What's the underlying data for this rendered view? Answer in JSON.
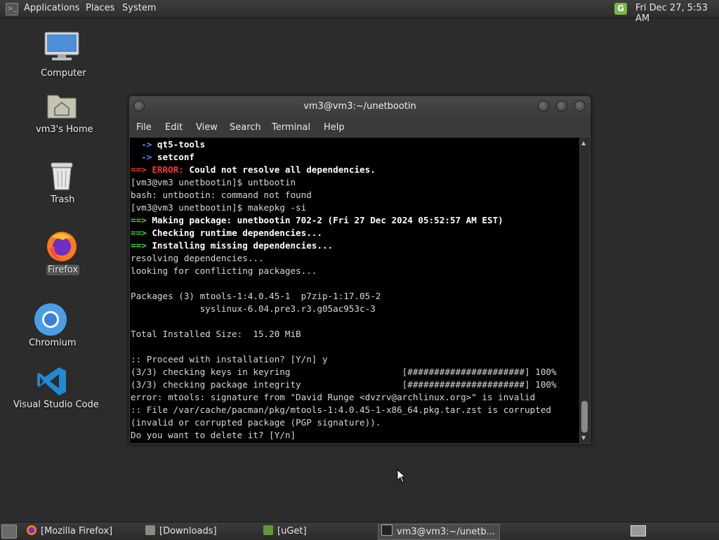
{
  "top_panel": {
    "menu": [
      "Applications",
      "Places",
      "System"
    ],
    "clock": "Fri Dec 27,  5:53 AM"
  },
  "desktop_icons": [
    "Computer",
    "vm3's Home",
    "Trash",
    "Firefox",
    "Chromium",
    "Visual Studio Code"
  ],
  "terminal": {
    "title": "vm3@vm3:~/unetbootin",
    "menu": [
      "File",
      "Edit",
      "View",
      "Search",
      "Terminal",
      "Help"
    ],
    "lines": [
      "  -> qt5-tools",
      "  -> setconf",
      "==> ERROR: Could not resolve all dependencies.",
      "[vm3@vm3 unetbootin]$ untbootin",
      "bash: untbootin: command not found",
      "[vm3@vm3 unetbootin]$ makepkg -si",
      "==> Making package: unetbootin 702-2 (Fri 27 Dec 2024 05:52:57 AM EST)",
      "==> Checking runtime dependencies...",
      "==> Installing missing dependencies...",
      "resolving dependencies...",
      "looking for conflicting packages...",
      "",
      "Packages (3) mtools-1:4.0.45-1  p7zip-1:17.05-2",
      "             syslinux-6.04.pre3.r3.g05ac953c-3",
      "",
      "Total Installed Size:  15.20 MiB",
      "",
      ":: Proceed with installation? [Y/n] y",
      "(3/3) checking keys in keyring                     [######################] 100%",
      "(3/3) checking package integrity                   [######################] 100%",
      "error: mtools: signature from \"David Runge <dvzrv@archlinux.org>\" is invalid",
      ":: File /var/cache/pacman/pkg/mtools-1:4.0.45-1-x86_64.pkg.tar.zst is corrupted",
      "(invalid or corrupted package (PGP signature)).",
      "Do you want to delete it? [Y/n]"
    ]
  },
  "taskbar": {
    "tasks": [
      "[Mozilla Firefox]",
      "[Downloads]",
      "[uGet]",
      "vm3@vm3:~/unetb..."
    ]
  },
  "colors": {
    "prompt_arrow": "#33dd33",
    "error": "#ff3333",
    "sub_arrow": "#5b8bff",
    "terminal_bg": "#000000"
  }
}
